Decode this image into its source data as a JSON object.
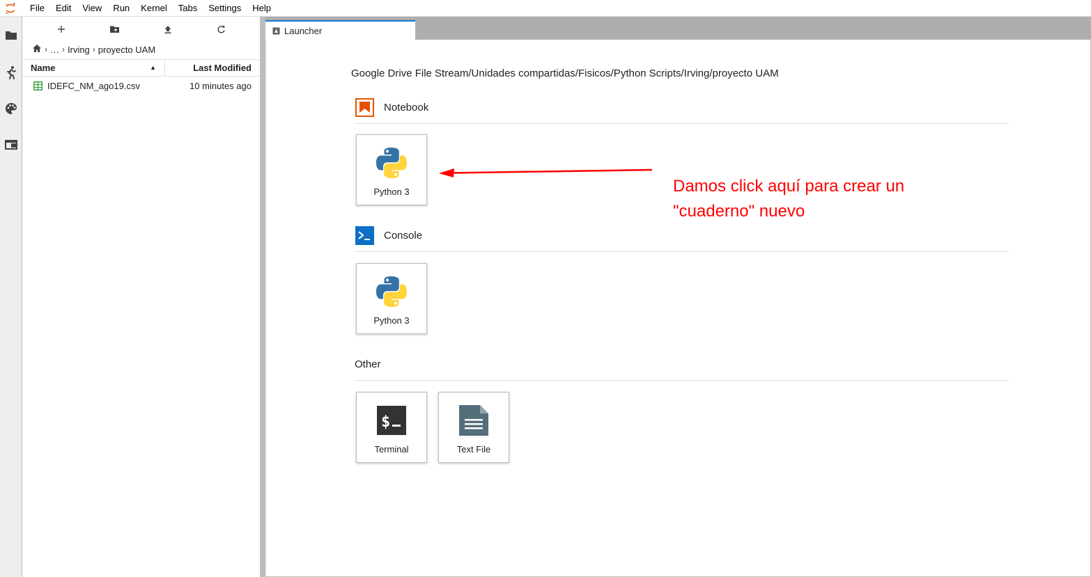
{
  "menubar": {
    "items": [
      "File",
      "Edit",
      "View",
      "Run",
      "Kernel",
      "Tabs",
      "Settings",
      "Help"
    ]
  },
  "filebrowser": {
    "breadcrumbs": [
      "…",
      "Irving",
      "proyecto UAM"
    ],
    "columns": {
      "name": "Name",
      "modified": "Last Modified"
    },
    "files": [
      {
        "name": "IDEFC_NM_ago19.csv",
        "modified": "10 minutes ago",
        "icon": "spreadsheet-icon"
      }
    ]
  },
  "tabs": [
    {
      "label": "Launcher"
    }
  ],
  "launcher": {
    "cwd": "Google Drive File Stream/Unidades compartidas/Fisicos/Python Scripts/Irving/proyecto UAM",
    "sections": {
      "notebook": {
        "title": "Notebook",
        "cards": [
          {
            "label": "Python 3"
          }
        ]
      },
      "console": {
        "title": "Console",
        "cards": [
          {
            "label": "Python 3"
          }
        ]
      },
      "other": {
        "title": "Other",
        "cards": [
          {
            "label": "Terminal"
          },
          {
            "label": "Text File"
          }
        ]
      }
    }
  },
  "annotation": {
    "line1": "Damos click aquí para crear un",
    "line2": "\"cuaderno\" nuevo",
    "color": "#ff0000"
  },
  "colors": {
    "accent": "#1976d2",
    "notebook_orange": "#e65100",
    "console_blue": "#0d6fc5",
    "python_blue": "#3572a5",
    "python_yellow": "#ffd43b",
    "csv_green": "#43a047"
  }
}
